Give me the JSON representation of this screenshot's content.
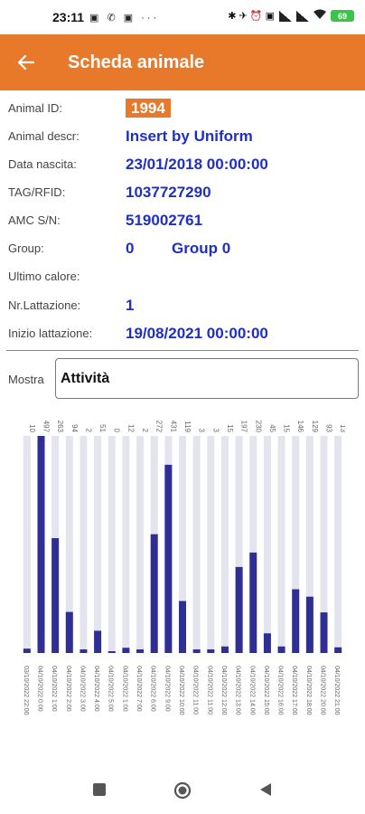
{
  "status_bar": {
    "time": "23:11",
    "left_icons": "▣ ✆ ▣ ···",
    "right_icons": "✱ ✈ ⏰ ▣",
    "battery": "69"
  },
  "app_bar": {
    "title": "Scheda animale",
    "back_icon": "arrow-left-icon"
  },
  "details": {
    "animal_id_label": "Animal ID:",
    "animal_id": "1994",
    "animal_descr_label": "Animal descr:",
    "animal_descr": "Insert by Uniform",
    "data_nascita_label": "Data nascita:",
    "data_nascita": "23/01/2018 00:00:00",
    "tag_label": "TAG/RFID:",
    "tag": "1037727290",
    "amc_label": "AMC S/N:",
    "amc": "519002761",
    "group_label": "Group:",
    "group_num": "0",
    "group_name": "Group 0",
    "ultimo_calore_label": "Ultimo calore:",
    "ultimo_calore": "",
    "nr_lattazione_label": "Nr.Lattazione:",
    "nr_lattazione": "1",
    "inizio_lattazione_label": "Inizio lattazione:",
    "inizio_lattazione": "19/08/2021 00:00:00"
  },
  "mostra": {
    "label": "Mostra",
    "value": "Attività"
  },
  "chart_data": {
    "type": "bar",
    "bar_color": "#2e2e96",
    "track_color": "#e4e4ef",
    "label_color": "#666666",
    "categories": [
      "03/10/2022 22:00",
      "04/10/2022 0:00",
      "04/10/2022 1:00",
      "04/10/2022 2:00",
      "04/10/2022 3:00",
      "04/10/2022 4:00",
      "04/10/2022 5:00",
      "04/10/2022 1:00",
      "04/10/2022 7:00",
      "04/10/2022 6:00",
      "04/10/2022 9:00",
      "04/10/2022 10:00",
      "04/10/2022 11:00",
      "04/10/2022 11:00",
      "04/10/2022 12:00",
      "04/10/2022 13:00",
      "04/10/2022 14:00",
      "04/10/2022 15:00",
      "04/10/2022 16:00",
      "04/10/2022 17:00",
      "04/10/2022 18:00",
      "04/10/2022 20:00",
      "04/10/2022 21:00"
    ],
    "values": [
      10,
      497,
      263,
      94,
      2,
      51,
      0,
      12,
      2,
      272,
      431,
      119,
      3,
      3,
      15,
      197,
      230,
      45,
      15,
      146,
      129,
      93,
      13
    ],
    "ylim": [
      0,
      497
    ]
  },
  "nav_bar": {
    "recents": "square-icon",
    "home": "circle-icon",
    "back": "triangle-back-icon"
  }
}
